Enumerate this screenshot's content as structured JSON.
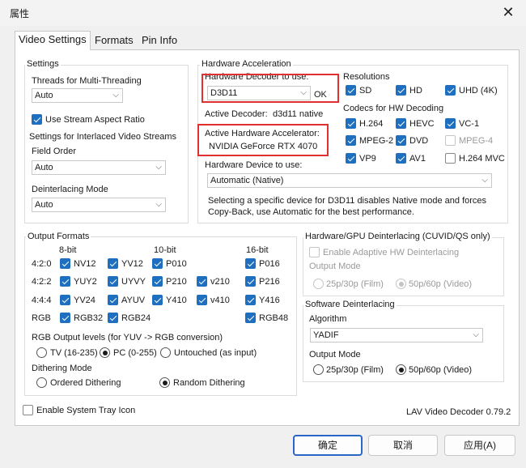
{
  "window": {
    "title": "属性",
    "close": "✕"
  },
  "tabs": [
    "Video Settings",
    "Formats",
    "Pin Info"
  ],
  "settings": {
    "title": "Settings",
    "threads_label": "Threads for Multi-Threading",
    "threads_value": "Auto",
    "stream_aspect": "Use Stream Aspect Ratio",
    "interlaced_title": "Settings for Interlaced Video Streams",
    "field_order_label": "Field Order",
    "field_order_value": "Auto",
    "deint_mode_label": "Deinterlacing Mode",
    "deint_mode_value": "Auto"
  },
  "hwaccel": {
    "title": "Hardware Acceleration",
    "decoder_label": "Hardware Decoder to use:",
    "decoder_value": "D3D11",
    "ok_label": "OK",
    "active_decoder_label": "Active Decoder:",
    "active_decoder_value": "d3d11 native",
    "accel_label": "Active Hardware Accelerator:",
    "accel_value": "NVIDIA GeForce RTX 4070",
    "device_label": "Hardware Device to use:",
    "device_value": "Automatic (Native)",
    "note": "Selecting a specific device for D3D11 disables Native mode and forces Copy-Back, use Automatic for the best performance.",
    "resolutions_title": "Resolutions",
    "resolutions": [
      "SD",
      "HD",
      "UHD (4K)"
    ],
    "codecs_title": "Codecs for HW Decoding",
    "codecs": [
      "H.264",
      "HEVC",
      "VC-1",
      "MPEG-2",
      "DVD",
      "MPEG-4",
      "VP9",
      "AV1",
      "H.264 MVC"
    ]
  },
  "output": {
    "title": "Output Formats",
    "col_8bit": "8-bit",
    "col_10bit": "10-bit",
    "col_16bit": "16-bit",
    "rows": [
      "4:2:0",
      "4:2:2",
      "4:4:4",
      "RGB"
    ],
    "formats": [
      "NV12",
      "YV12",
      "P010",
      "P016",
      "YUY2",
      "UYVY",
      "P210",
      "v210",
      "P216",
      "YV24",
      "AYUV",
      "Y410",
      "v410",
      "Y416",
      "RGB32",
      "RGB24",
      "RGB48"
    ],
    "levels_label": "RGB Output levels (for YUV -> RGB conversion)",
    "levels": [
      "TV (16-235)",
      "PC (0-255)",
      "Untouched (as input)"
    ],
    "dither_label": "Dithering Mode",
    "dither": [
      "Ordered Dithering",
      "Random Dithering"
    ]
  },
  "hwdeint": {
    "title": "Hardware/GPU Deinterlacing (CUVID/QS only)",
    "adaptive": "Enable Adaptive HW Deinterlacing",
    "output_mode_label": "Output Mode",
    "modes": [
      "25p/30p (Film)",
      "50p/60p (Video)"
    ]
  },
  "swdeint": {
    "title": "Software Deinterlacing",
    "algorithm_label": "Algorithm",
    "algorithm_value": "YADIF",
    "output_mode_label": "Output Mode",
    "modes": [
      "25p/30p (Film)",
      "50p/60p (Video)"
    ]
  },
  "tray_label": "Enable System Tray Icon",
  "version": "LAV Video Decoder 0.79.2",
  "buttons": {
    "ok": "确定",
    "cancel": "取消",
    "apply": "应用(A)"
  },
  "icons": {
    "caret": "⌵"
  }
}
